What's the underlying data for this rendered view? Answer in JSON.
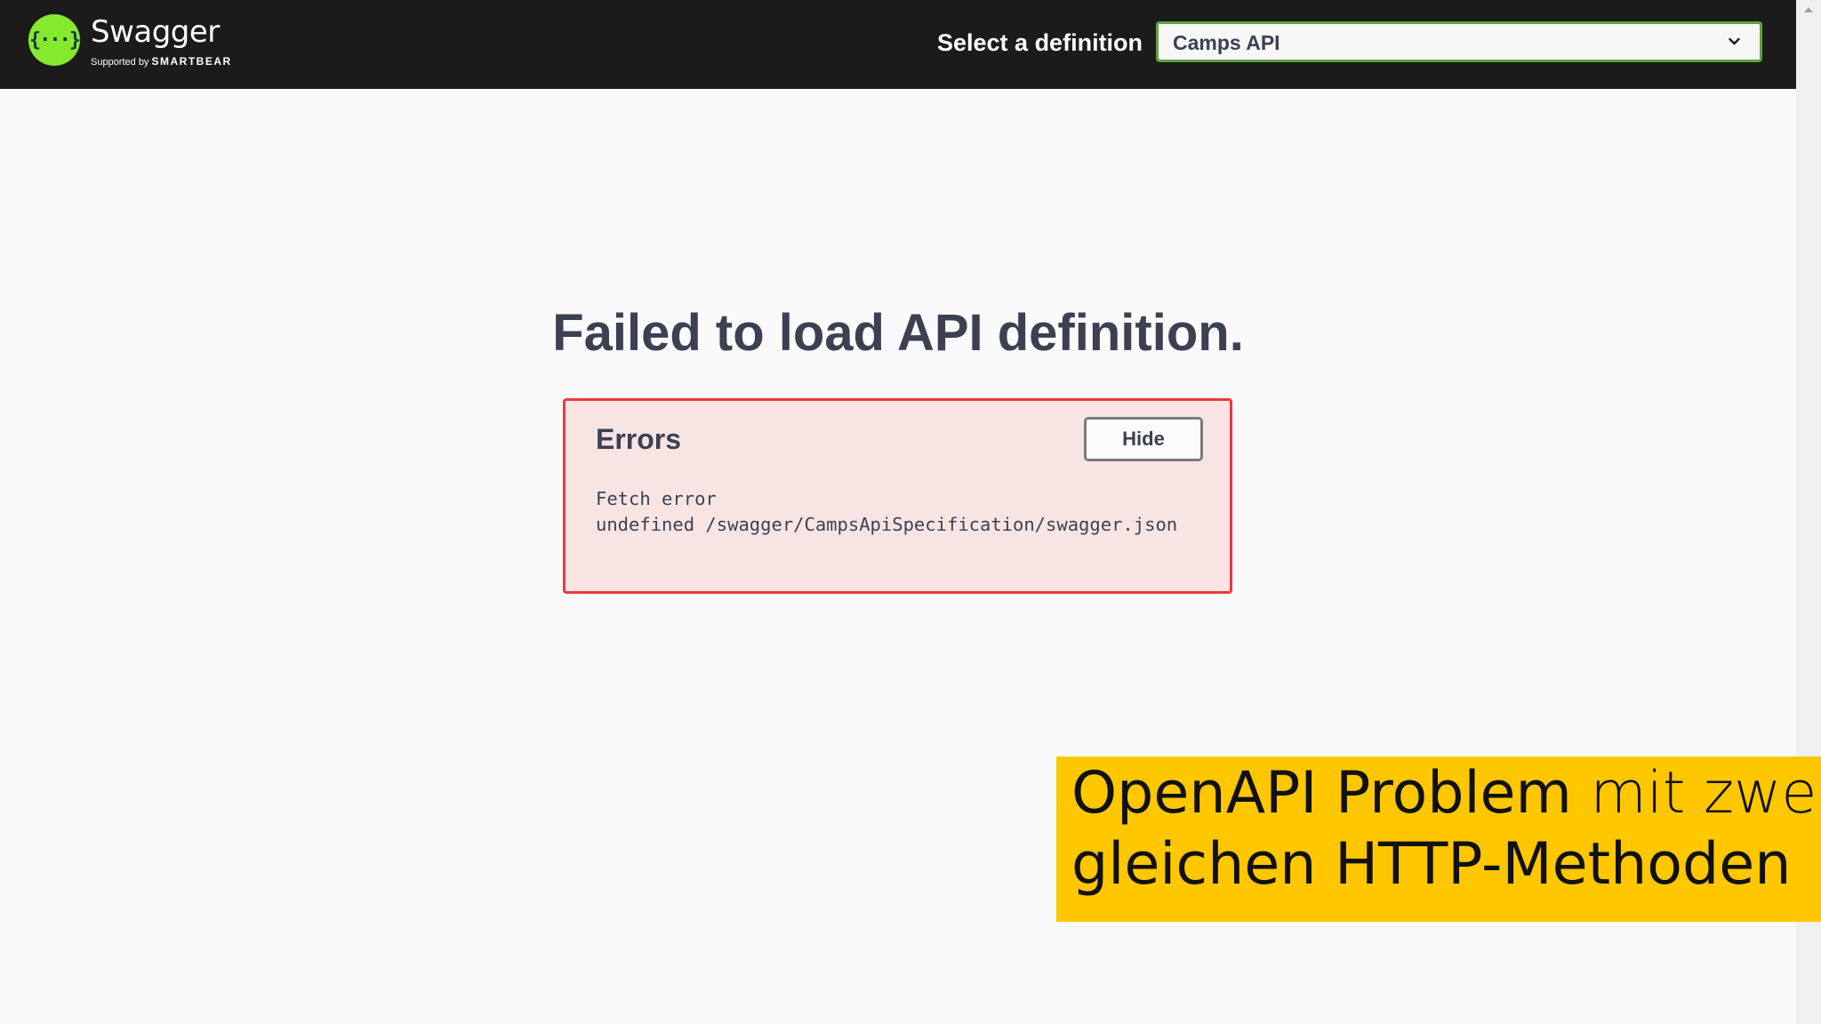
{
  "header": {
    "logo": {
      "mark": "{···}",
      "name": "Swagger",
      "supported_by": "Supported by",
      "brand": "SMARTBEAR"
    },
    "definition_label": "Select a definition",
    "definition_select": {
      "value": "Camps API",
      "icon": "chevron-down-icon"
    }
  },
  "main": {
    "title": "Failed to load API definition.",
    "errors": {
      "title": "Errors",
      "hide_label": "Hide",
      "lines": [
        "Fetch error",
        "undefined /swagger/CampsApiSpecification/swagger.json"
      ]
    }
  },
  "banner": {
    "line1_bold": "OpenAPI Problem",
    "line1_light": " mit zwei",
    "line2": "gleichen HTTP-Methoden"
  },
  "colors": {
    "topbar": "#1b1b1b",
    "logo_green": "#85ea2d",
    "select_border": "#62a03f",
    "error_border": "#e63b3b",
    "error_bg": "#f9e4e4",
    "banner_bg": "#ffc700",
    "text": "#3b4151"
  }
}
